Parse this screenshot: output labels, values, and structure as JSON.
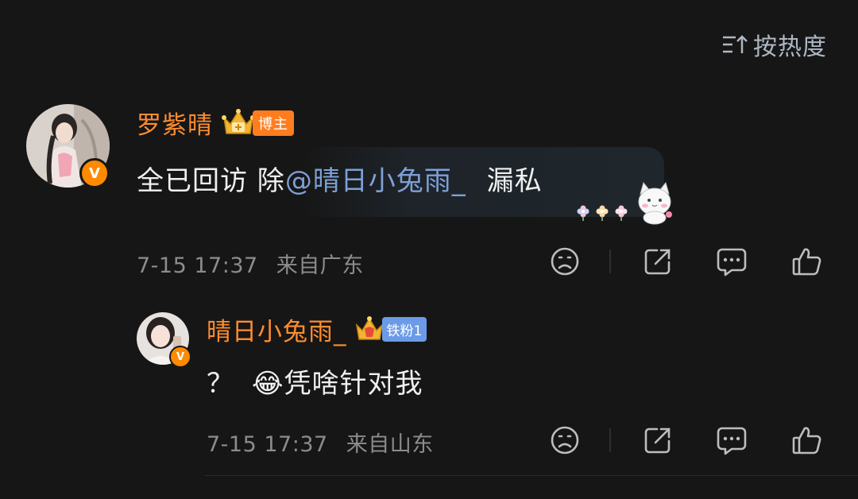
{
  "sort": {
    "label": "按热度",
    "icon": "sort-icon"
  },
  "comments": [
    {
      "username": "罗紫晴",
      "badge_label": "博主",
      "text_prefix": "全已回访 除",
      "mention": "@晴日小兔雨_",
      "text_suffix": " 漏私",
      "time": "7-15 17:37",
      "location": "来自广东",
      "verified_mark": "V"
    },
    {
      "username": "晴日小兔雨_",
      "badge_label": "铁粉1",
      "text_prefix": "？",
      "emoji": "😂",
      "text_suffix": "凭啥针对我",
      "time": "7-15 17:37",
      "location": "来自山东",
      "verified_mark": "V"
    }
  ],
  "colors": {
    "background": "#161616",
    "username": "#ff8d30",
    "mention": "#7da0d6",
    "meta": "#8c8c8c",
    "verified": "#ff8a00"
  }
}
